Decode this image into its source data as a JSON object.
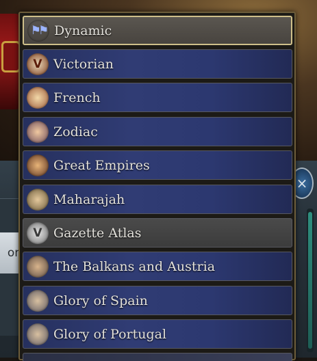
{
  "background": {
    "side_button_label": "on",
    "round_button_glyph": "×"
  },
  "dropdown": {
    "selected_index": 0,
    "items": [
      {
        "label": "Dynamic",
        "icon": "flags-icon"
      },
      {
        "label": "Victorian",
        "icon": "victoria-v-icon"
      },
      {
        "label": "French",
        "icon": "french-portrait-icon"
      },
      {
        "label": "Zodiac",
        "icon": "zodiac-portrait-icon"
      },
      {
        "label": "Great Empires",
        "icon": "ship-icon"
      },
      {
        "label": "Maharajah",
        "icon": "maharajah-portrait-icon"
      },
      {
        "label": "Gazette Atlas",
        "icon": "victoria-v-icon"
      },
      {
        "label": "The Balkans and Austria",
        "icon": "soldier-portrait-icon"
      },
      {
        "label": "Glory of Spain",
        "icon": "soldier-portrait-icon"
      },
      {
        "label": "Glory of Portugal",
        "icon": "soldier-portrait-icon"
      }
    ]
  }
}
